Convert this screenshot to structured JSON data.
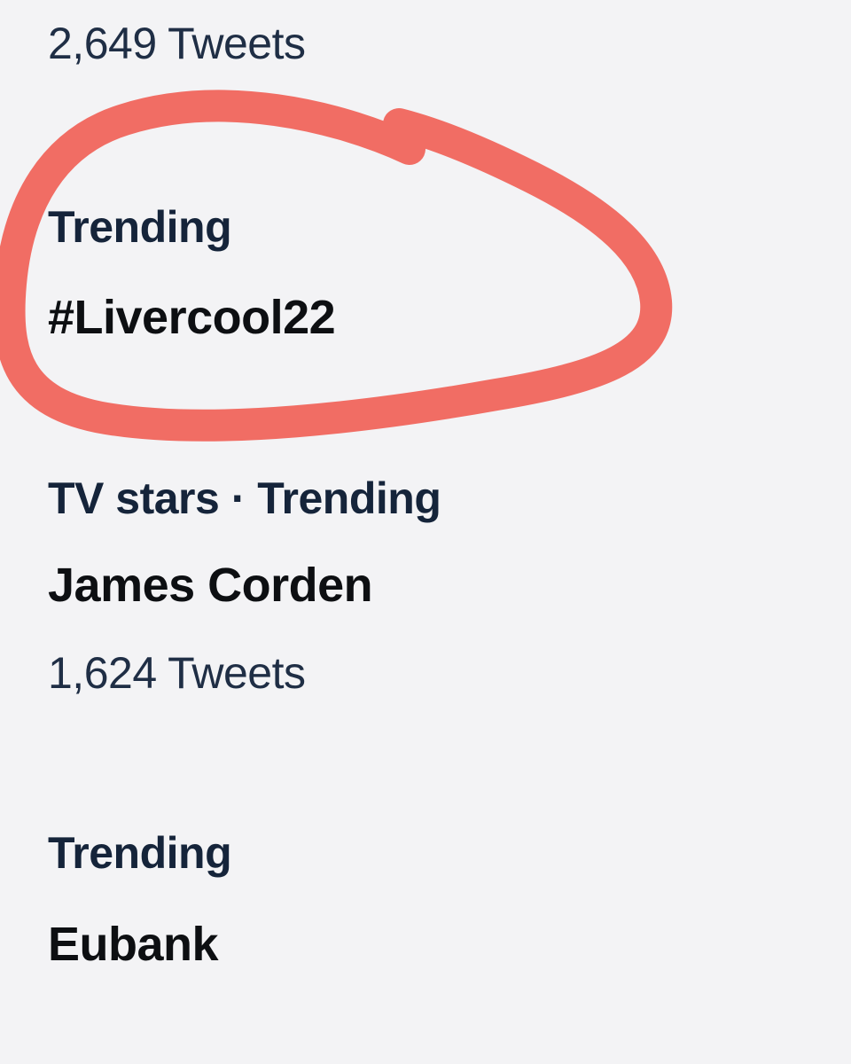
{
  "trends": [
    {
      "tweets": "2,649 Tweets"
    },
    {
      "context": "Trending",
      "name": "#Livercool22",
      "highlighted": true
    },
    {
      "context": "TV stars · Trending",
      "name": "James Corden",
      "tweets": "1,624 Tweets"
    },
    {
      "context": "Trending",
      "name": "Eubank"
    }
  ],
  "colors": {
    "background": "#f3f3f5",
    "meta_text": "#1f2e45",
    "topic_text": "#0d0f12",
    "highlight_stroke": "#f0655c"
  }
}
